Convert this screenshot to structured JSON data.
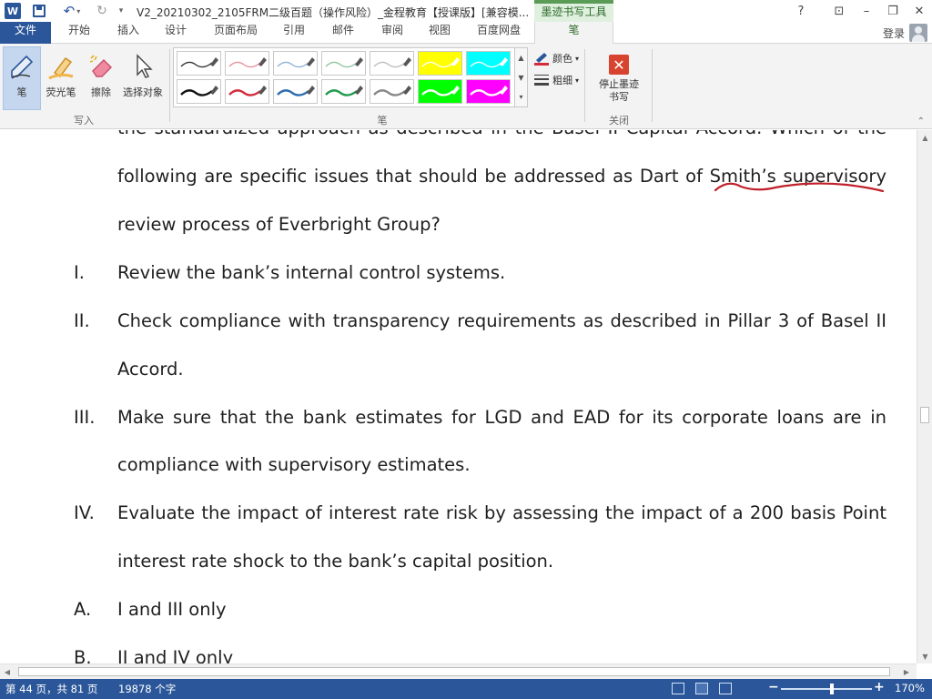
{
  "titlebar": {
    "app_icon_letter": "W",
    "document_title": "V2_20210302_2105FRM二级百题（操作风险）_金程教育【授课版】[兼容模...",
    "tool_tab_title": "墨迹书写工具",
    "help": "?",
    "ribbon_options": "⊡",
    "minimize": "–",
    "restore": "❐",
    "close": "✕"
  },
  "tabs": [
    {
      "label": "文件"
    },
    {
      "label": "开始"
    },
    {
      "label": "插入"
    },
    {
      "label": "设计"
    },
    {
      "label": "页面布局"
    },
    {
      "label": "引用"
    },
    {
      "label": "邮件"
    },
    {
      "label": "审阅"
    },
    {
      "label": "视图"
    },
    {
      "label": "百度网盘"
    },
    {
      "label": "笔"
    }
  ],
  "login_label": "登录",
  "ribbon": {
    "write_group": {
      "label": "写入",
      "pen": "笔",
      "highlighter": "荧光笔",
      "eraser": "擦除",
      "select": "选择对象"
    },
    "pens_group": {
      "label": "笔",
      "color": "颜色",
      "thickness": "粗细",
      "swatch_colors_row1": [
        "#333333",
        "#e8909a",
        "#8fb0d6",
        "#8cc59d",
        "#bdbdbd",
        "#ffff00",
        "#00ffff"
      ],
      "swatch_colors_row2": [
        "#111111",
        "#d42b3c",
        "#2b6cb0",
        "#1f9a4c",
        "#888888",
        "#00ff00",
        "#ff00ff"
      ]
    },
    "close_group": {
      "label": "关闭",
      "stop_inking": "停止墨迹书写"
    }
  },
  "document": {
    "partial_top_line": "the standardized approach as described in the Basel II Capital Accord. Which of the",
    "question_line_1": "following are specific issues that should be addressed as Dart of Smith’s supervisory",
    "question_line_2": "review process of Everbright Group?",
    "items": [
      {
        "numeral": "I.",
        "lines": [
          "Review the bank’s internal control systems."
        ]
      },
      {
        "numeral": "II.",
        "lines": [
          "Check compliance with transparency requirements as described in Pillar 3 of Basel II",
          "Accord."
        ]
      },
      {
        "numeral": "III.",
        "lines": [
          "Make sure that the bank estimates for LGD and EAD for its corporate loans are in",
          "compliance with supervisory estimates."
        ]
      },
      {
        "numeral": "IV.",
        "lines": [
          "Evaluate the impact of interest rate risk by assessing the impact of a 200 basis Point",
          "interest rate shock to the bank’s capital position."
        ]
      }
    ],
    "options": [
      {
        "letter": "A.",
        "text": "I and III only"
      },
      {
        "letter": "B.",
        "text": "II and IV only"
      }
    ],
    "ink_color": "#c0202a"
  },
  "statusbar": {
    "page_info": "第 44 页，共 81 页",
    "word_count": "19878 个字",
    "zoom_level": "170%",
    "zoom_minus": "−",
    "zoom_plus": "+"
  },
  "colors": {
    "word_blue": "#2b579a",
    "tool_tab_green": "#5a9b55",
    "stop_red": "#d7432f"
  }
}
